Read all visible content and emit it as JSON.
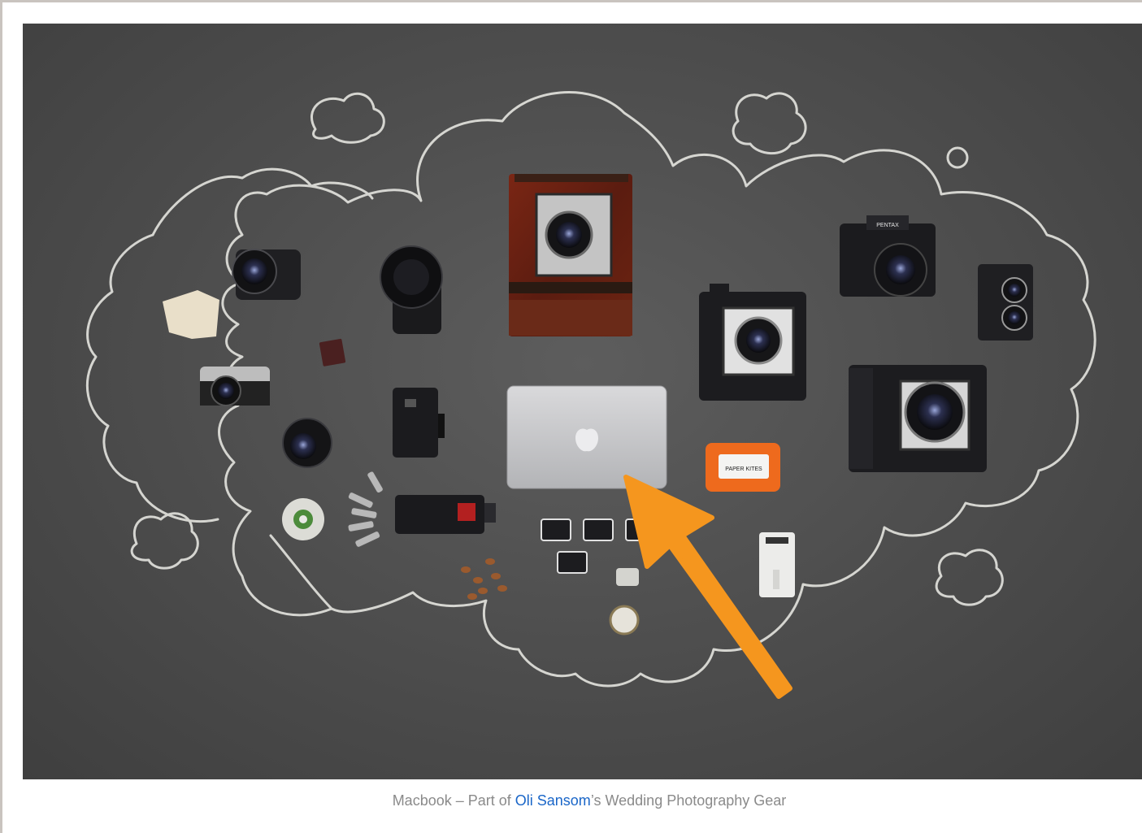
{
  "caption": {
    "prefix": "Macbook – Part of ",
    "link_text": "Oli Sansom",
    "suffix": "’s Wedding Photography Gear"
  },
  "photo": {
    "subject": "flat-lay photography gear on chalkboard",
    "labels": {
      "pentax_brand": "PENTAX",
      "drive_label": "PAPER KITES"
    }
  },
  "colors": {
    "arrow": "#f5961e",
    "chalk": "#e8e8e4",
    "link": "#1a66c8",
    "caption_text": "#8a8a8a",
    "drive_orange": "#ee6a1d"
  }
}
